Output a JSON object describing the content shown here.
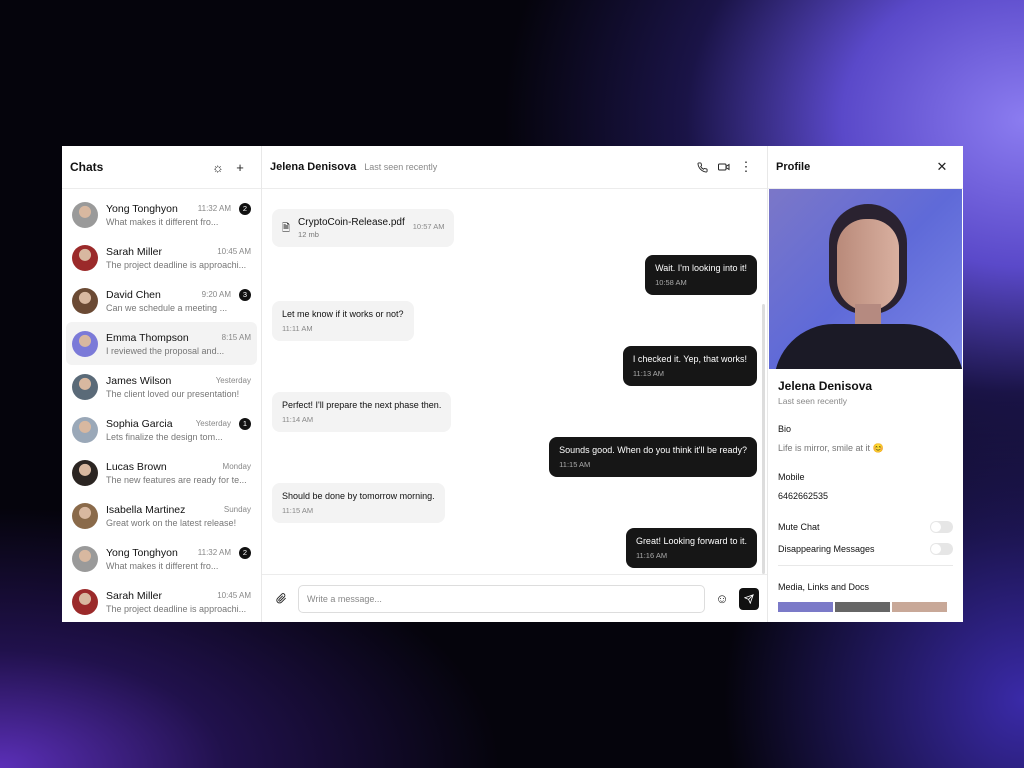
{
  "left": {
    "title": "Chats",
    "icons": [
      "sun-icon",
      "plus-icon"
    ],
    "chats": [
      {
        "name": "Yong Tonghyon",
        "time": "11:32 AM",
        "preview": "What makes it different fro...",
        "badge": "2",
        "color": "#9a9a9a"
      },
      {
        "name": "Sarah Miller",
        "time": "10:45 AM",
        "preview": "The project deadline is approachi...",
        "badge": "",
        "color": "#9b2a2a"
      },
      {
        "name": "David Chen",
        "time": "9:20 AM",
        "preview": "Can we schedule a meeting ...",
        "badge": "3",
        "color": "#6b4a34"
      },
      {
        "name": "Emma Thompson",
        "time": "8:15 AM",
        "preview": "I reviewed the proposal and...",
        "badge": "",
        "color": "#7b7ad8",
        "selected": true
      },
      {
        "name": "James Wilson",
        "time": "Yesterday",
        "preview": "The client loved our presentation!",
        "badge": "",
        "color": "#5a6a78"
      },
      {
        "name": "Sophia Garcia",
        "time": "Yesterday",
        "preview": "Lets finalize the design tom...",
        "badge": "1",
        "color": "#9aa8b8"
      },
      {
        "name": "Lucas Brown",
        "time": "Monday",
        "preview": "The new features are ready for te...",
        "badge": "",
        "color": "#2b2522"
      },
      {
        "name": "Isabella Martinez",
        "time": "Sunday",
        "preview": "Great work on the latest release!",
        "badge": "",
        "color": "#8a6a4a"
      },
      {
        "name": "Yong Tonghyon",
        "time": "11:32 AM",
        "preview": "What makes it different fro...",
        "badge": "2",
        "color": "#9a9a9a"
      },
      {
        "name": "Sarah Miller",
        "time": "10:45 AM",
        "preview": "The project deadline is approachi...",
        "badge": "",
        "color": "#9b2a2a"
      }
    ]
  },
  "chat": {
    "name": "Jelena Denisova",
    "status": "Last seen recently",
    "file": {
      "name": "CryptoCoin-Release.pdf",
      "size": "12 mb",
      "time": "10:57 AM"
    },
    "messages": [
      {
        "dir": "out",
        "text": "Wait. I'm looking into it!",
        "time": "10:58 AM"
      },
      {
        "dir": "in",
        "text": "Let me know if it works or not?",
        "time": "11:11 AM"
      },
      {
        "dir": "out",
        "text": "I checked it. Yep, that works!",
        "time": "11:13 AM"
      },
      {
        "dir": "in",
        "text": "Perfect! I'll prepare the next phase then.",
        "time": "11:14 AM"
      },
      {
        "dir": "out",
        "text": "Sounds good. When do you think it'll be ready?",
        "time": "11:15 AM"
      },
      {
        "dir": "in",
        "text": "Should be done by tomorrow morning.",
        "time": "11:15 AM"
      },
      {
        "dir": "out",
        "text": "Great! Looking forward to it.",
        "time": "11:16 AM"
      }
    ],
    "placeholder": "Write a message..."
  },
  "profile": {
    "title": "Profile",
    "name": "Jelena Denisova",
    "status": "Last seen recently",
    "bio_label": "Bio",
    "bio": "Life is mirror, smile at it 😊",
    "mobile_label": "Mobile",
    "mobile": "6462662535",
    "mute": {
      "label": "Mute Chat",
      "on": false
    },
    "disappearing": {
      "label": "Disappearing Messages",
      "on": false
    },
    "media_label": "Media, Links and Docs"
  }
}
